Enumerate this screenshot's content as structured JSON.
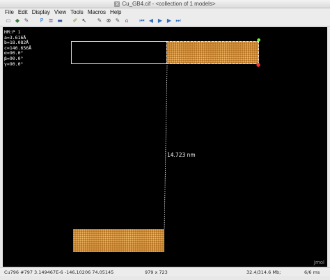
{
  "window": {
    "title": "Cu_GB4.cif - <collection of 1 models>"
  },
  "menubar": {
    "items": [
      "File",
      "Edit",
      "Display",
      "View",
      "Tools",
      "Macros",
      "Help"
    ]
  },
  "toolbar": {
    "icons": [
      {
        "name": "open-file-icon",
        "glyph": "▭",
        "color": "#5a6f8a"
      },
      {
        "name": "open-pdb-icon",
        "glyph": "◆",
        "color": "#3a7a3a"
      },
      {
        "name": "script-icon",
        "glyph": "✎",
        "color": "#555555"
      },
      {
        "name": "save-image-icon",
        "glyph": "P",
        "color": "#2c7bd1"
      },
      {
        "name": "run-script-icon",
        "glyph": "≣",
        "color": "#7a4a9a"
      },
      {
        "name": "undo-display-icon",
        "glyph": "▬",
        "color": "#3456a0"
      },
      {
        "name": "measure-icon",
        "glyph": "✐",
        "color": "#6a9a1a"
      },
      {
        "name": "select-pointer-icon",
        "glyph": "↖",
        "color": "#222222"
      },
      {
        "name": "rotate-icon",
        "glyph": "✎",
        "color": "#555555"
      },
      {
        "name": "zoom-icon",
        "glyph": "⊗",
        "color": "#444444"
      },
      {
        "name": "pick-atoms-icon",
        "glyph": "✎",
        "color": "#555555"
      },
      {
        "name": "home-icon",
        "glyph": "⌂",
        "color": "#d04020"
      },
      {
        "name": "animation-first-icon",
        "glyph": "⏮",
        "color": "#2f6fbf"
      },
      {
        "name": "animation-prev-icon",
        "glyph": "◀",
        "color": "#2f6fbf"
      },
      {
        "name": "animation-play-icon",
        "glyph": "▶",
        "color": "#2f6fbf"
      },
      {
        "name": "animation-next-icon",
        "glyph": "▶",
        "color": "#2f6fbf"
      },
      {
        "name": "animation-last-icon",
        "glyph": "⏭",
        "color": "#2f6fbf"
      }
    ]
  },
  "viewer": {
    "info_lines": [
      "HM:P 1",
      "a=3.616Å",
      "b=18.082Å",
      "c=146.656Å",
      "α=90.0°",
      "β=90.0°",
      "γ=90.0°"
    ],
    "measurement": "14.723 nm",
    "watermark": "Jmol",
    "crystal_color": "#b5711f",
    "atom_highlight_color": "#f0b765"
  },
  "statusbar": {
    "atom_info": "Cu796 #797 3.149467E-6 -146.10206 74.05145",
    "dimensions": "979 x 723",
    "memory": "32.4/314.6 Mb;",
    "timing": "6/6 ms"
  }
}
